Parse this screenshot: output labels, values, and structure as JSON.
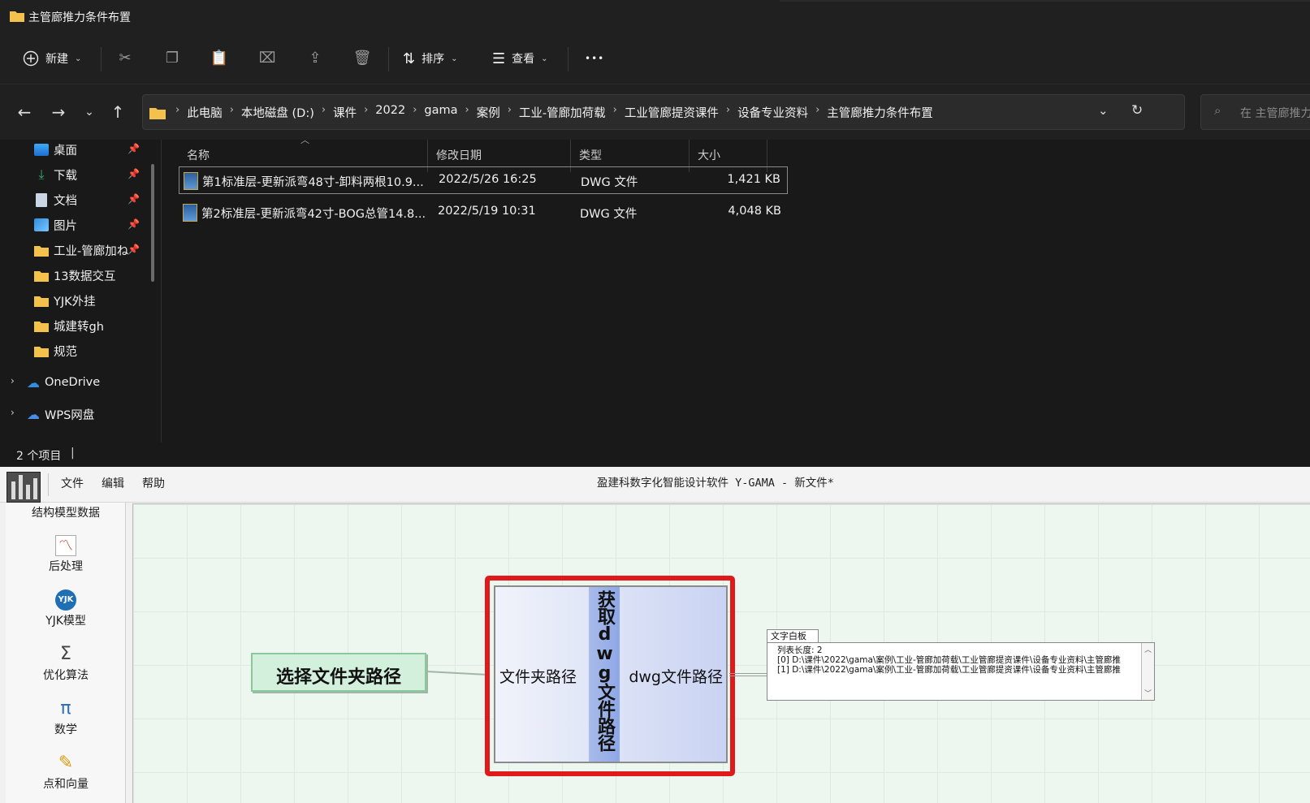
{
  "explorer": {
    "title": "主管廊推力条件布置",
    "toolbar": {
      "new_label": "新建",
      "sort_label": "排序",
      "view_label": "查看",
      "more_label": "•••"
    },
    "breadcrumbs": [
      "此电脑",
      "本地磁盘 (D:)",
      "课件",
      "2022",
      "gama",
      "案例",
      "工业-管廊加荷载",
      "工业管廊提资课件",
      "设备专业资料",
      "主管廊推力条件布置"
    ],
    "search_placeholder": "在 主管廊推力",
    "sidebar": {
      "pinned": [
        {
          "label": "桌面",
          "icon": "desktop-icon"
        },
        {
          "label": "下载",
          "icon": "download-icon"
        },
        {
          "label": "文档",
          "icon": "document-icon"
        },
        {
          "label": "图片",
          "icon": "picture-icon"
        },
        {
          "label": "工业-管廊加ね",
          "icon": "folder-icon"
        }
      ],
      "folders": [
        "13数据交互",
        "YJK外挂",
        "城建转gh",
        "规范"
      ],
      "drives": [
        "OneDrive",
        "WPS网盘"
      ]
    },
    "columns": {
      "name": "名称",
      "modified": "修改日期",
      "type": "类型",
      "size": "大小"
    },
    "files": [
      {
        "name": "第1标准层-更新派弯48寸-卸料两根10.9...",
        "modified": "2022/5/26 16:25",
        "type": "DWG 文件",
        "size": "1,421 KB"
      },
      {
        "name": "第2标准层-更新派弯42寸-BOG总管14.8...",
        "modified": "2022/5/19 10:31",
        "type": "DWG 文件",
        "size": "4,048 KB"
      }
    ],
    "status": "2 个项目"
  },
  "gama": {
    "menus": [
      "文件",
      "编辑",
      "帮助"
    ],
    "title": "盈建科数字化智能设计软件 Y-GAMA - 新文件*",
    "panel": {
      "header": "结构模型数据",
      "items": [
        {
          "label": "后处理",
          "icon": "chart-icon"
        },
        {
          "label": "YJK模型",
          "icon": "yjk-logo-icon"
        },
        {
          "label": "优化算法",
          "icon": "sigma-icon"
        },
        {
          "label": "数学",
          "icon": "pi-icon"
        },
        {
          "label": "点和向量",
          "icon": "point-vector-icon"
        }
      ]
    },
    "canvas": {
      "source_node": "选择文件夹路径",
      "component": {
        "title": "获取dwg文件路径",
        "input": "文件夹路径",
        "output": "dwg文件路径"
      },
      "text_panel": {
        "tag": "文字白板",
        "lines": [
          "列表长度: 2",
          "[0] D:\\课件\\2022\\gama\\案例\\工业-管廊加荷载\\工业管廊提资课件\\设备专业资料\\主管廊推",
          "[1] D:\\课件\\2022\\gama\\案例\\工业-管廊加荷载\\工业管廊提资课件\\设备专业资料\\主管廊推"
        ]
      }
    }
  },
  "colors": {
    "highlight": "#e0191b",
    "canvas_bg": "#eef6f0",
    "source_node_bg": "#d2f0dc",
    "component_band": "#8ea7e6"
  }
}
